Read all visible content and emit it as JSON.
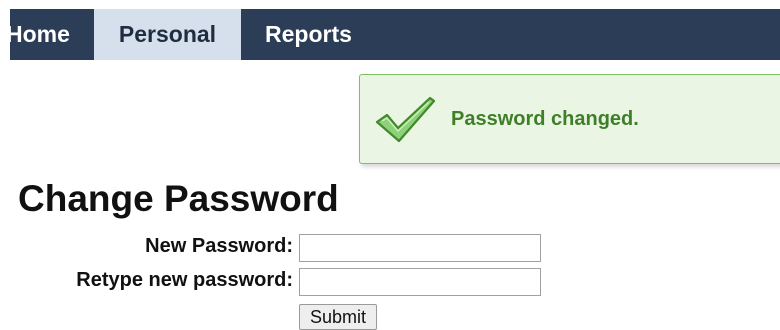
{
  "nav": {
    "tabs": [
      {
        "label": "Home",
        "active": false
      },
      {
        "label": "Personal",
        "active": true
      },
      {
        "label": "Reports",
        "active": false
      }
    ]
  },
  "notice": {
    "icon": "checkmark-icon",
    "message": "Password changed.",
    "colors": {
      "background": "#eaf6e3",
      "border": "#7fbf66",
      "text": "#3f7f2a"
    }
  },
  "page": {
    "title": "Change Password"
  },
  "form": {
    "new_password_label": "New Password:",
    "new_password_value": "",
    "retype_label": "Retype new password:",
    "retype_value": "",
    "submit_label": "Submit"
  },
  "colors": {
    "navbar": "#2c3e57",
    "active_tab": "#d6e0ec"
  }
}
